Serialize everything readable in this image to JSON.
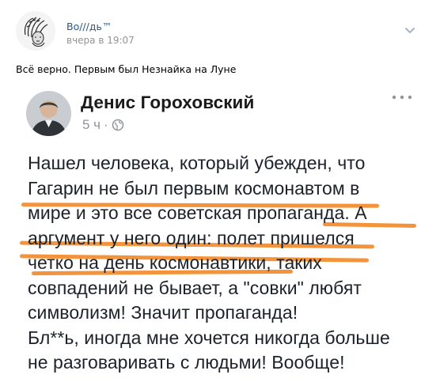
{
  "post": {
    "author": "Во///дь™",
    "time": "вчера в 19:07",
    "text": "Всё верно. Первым был Незнайка на Луне"
  },
  "embedded": {
    "name": "Денис Гороховский",
    "time": "5 ч",
    "separator": "·",
    "more": "···",
    "body_lines": [
      "Нашел человека, который убежден, что",
      "Гагарин не был первым космонавтом в",
      "мире и это все советская пропаганда. А",
      "аргумент у него один: полет пришелся",
      "четко на день космонавтики, таких",
      "совпадений не бывает, а \"совки\" любят",
      "символизм! Значит пропаганда!",
      "Бл**ь, иногда мне хочется никогда больше",
      "не разговаривать с людьми! Вообще!"
    ]
  },
  "colors": {
    "link": "#2a5885",
    "meta": "#939393",
    "highlight": "#f28a2b"
  }
}
